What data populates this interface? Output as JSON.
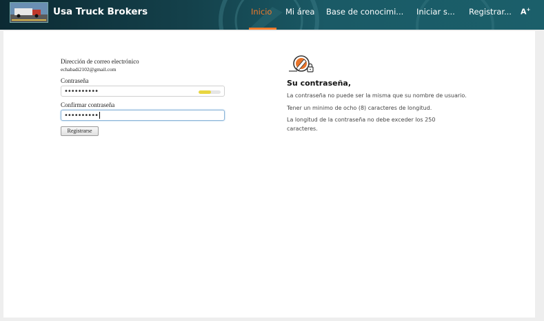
{
  "header": {
    "brand": "Usa Truck Brokers",
    "nav": [
      {
        "label": "Inicio",
        "active": true
      },
      {
        "label": "Mi área",
        "active": false
      },
      {
        "label": "Base de conocimi...",
        "active": false
      },
      {
        "label": "Iniciar s...",
        "active": false
      },
      {
        "label": "Registrar...",
        "active": false
      }
    ],
    "a11y": "A",
    "accent_color": "#f07a2b"
  },
  "form": {
    "email_label": "Dirección de correo electrónico",
    "email_value": "echabadi2102@gmail.com",
    "password_label": "Contraseña",
    "password_value": "••••••••••",
    "password_strength": 0.55,
    "confirm_label": "Confirmar contraseña",
    "confirm_value": "••••••••••",
    "submit_label": "Registrarse"
  },
  "rules": {
    "title": "Su contraseña,",
    "items": [
      "La contraseña no puede ser la misma que su nombre de usuario.",
      "Tener un minimo de ocho (8) caracteres de longitud.",
      "La longitud de la contraseña no debe exceder los 250 caracteres."
    ],
    "icon": "password-edit-lock-icon"
  }
}
